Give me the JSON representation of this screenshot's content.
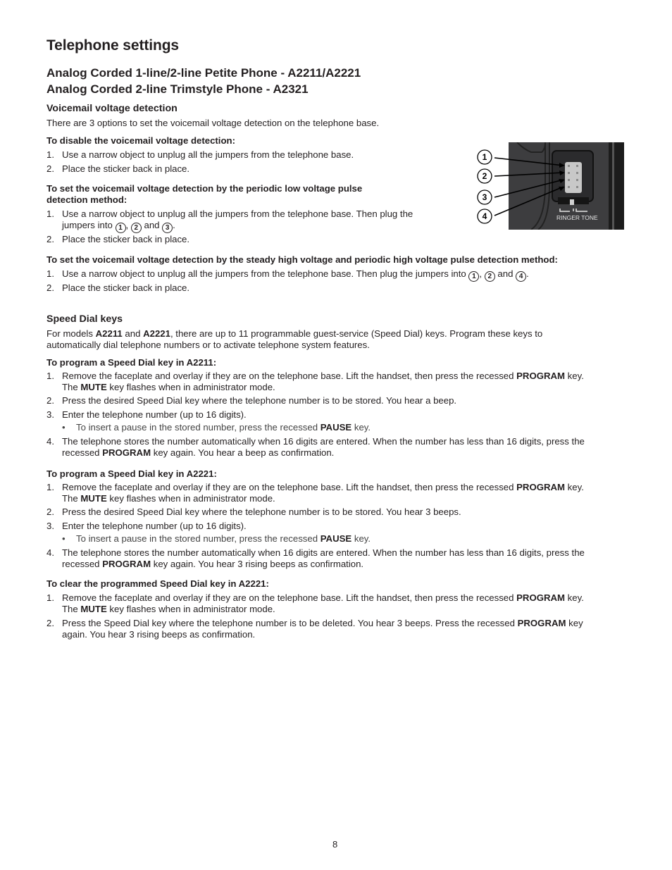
{
  "page_title": "Telephone settings",
  "model_headings": [
    "Analog Corded 1-line/2-line Petite Phone - A2211/A2221",
    "Analog Corded 2-line Trimstyle Phone - A2321"
  ],
  "voicemail": {
    "heading": "Voicemail voltage detection",
    "intro": "There are 3 options to set the voicemail voltage detection on the telephone base.",
    "disable": {
      "title": "To disable the voicemail voltage detection:",
      "steps": [
        "Use a narrow object to unplug all the jumpers from the telephone base.",
        "Place the sticker back in place."
      ]
    },
    "low_pulse": {
      "title_line1": "To set the voicemail voltage detection by the periodic low voltage pulse",
      "title_line2": "detection method:",
      "step1_line1": "Use a narrow object to unplug all the jumpers from the telephone base. Then plug the",
      "step1_prefix": "jumpers into ",
      "step1_circles": [
        "1",
        "2",
        "3"
      ],
      "sep_comma": ", ",
      "sep_and": " and ",
      "end_period": ".",
      "step2": "Place the sticker back in place."
    },
    "high_pulse": {
      "title": "To set the voicemail voltage detection by the steady high voltage and periodic high voltage pulse detection method:",
      "step1_prefix": "Use a narrow object to unplug all the jumpers from the telephone base. Then plug the jumpers into ",
      "step1_circles": [
        "1",
        "2",
        "4"
      ],
      "step2": "Place the sticker back in place."
    },
    "figure": {
      "callouts": [
        "1",
        "2",
        "3",
        "4"
      ],
      "label": "RINGER TONE",
      "colors": {
        "panel": "#3d3d3f",
        "dark": "#1c1c1c",
        "jumper": "#c8c8c8"
      }
    }
  },
  "speed_dial": {
    "heading": "Speed Dial keys",
    "intro_pre": "For models ",
    "model1": "A2211",
    "intro_and": " and ",
    "model2": "A2221",
    "intro_post": ", there are up to 11 programmable guest-service (Speed Dial) keys. Program these keys to",
    "intro_line2": "automatically dial telephone numbers or to activate telephone system features.",
    "a2211": {
      "title": "To program a Speed Dial key in A2211:",
      "s1_a": "Remove the faceplate and overlay if they are on the telephone base. Lift the handset, then press the recessed ",
      "s1_b": "PROGRAM",
      "s1_c": " key.",
      "s1_d": "The ",
      "s1_e": "MUTE",
      "s1_f": " key flashes when in administrator mode.",
      "s2": "Press the desired Speed Dial key where the telephone number is to be stored. You hear a beep.",
      "s3": "Enter the telephone number (up to 16 digits).",
      "bullet_a": "To insert a pause in the stored number, press the recessed ",
      "bullet_b": "PAUSE",
      "bullet_c": " key.",
      "s4_a": "The telephone stores the number automatically when 16 digits are entered. When the number has less than 16 digits, press the",
      "s4_b": "recessed ",
      "s4_c": "PROGRAM",
      "s4_d": " key again. You hear a beep as confirmation."
    },
    "a2221": {
      "title": "To program a Speed Dial key in A2221:",
      "s1_a": "Remove the faceplate and overlay if they are on the telephone base. Lift the handset, then press the recessed ",
      "s1_b": "PROGRAM",
      "s1_c": " key.",
      "s1_d": "The ",
      "s1_e": "MUTE",
      "s1_f": " key flashes when in administrator mode.",
      "s2": "Press the desired Speed Dial key where the telephone number is to be stored. You hear 3 beeps.",
      "s3": "Enter the telephone number (up to 16 digits).",
      "bullet_a": "To insert a pause in the stored number, press the recessed ",
      "bullet_b": "PAUSE",
      "bullet_c": " key.",
      "s4_a": "The telephone stores the number automatically when 16 digits are entered. When the number has less than 16 digits, press the",
      "s4_b": "recessed ",
      "s4_c": "PROGRAM",
      "s4_d": " key again. You hear 3 rising beeps as confirmation."
    },
    "clear": {
      "title": "To clear the programmed Speed Dial key in A2221:",
      "s1_a": "Remove the faceplate and overlay if they are on the telephone base. Lift the handset, then press the recessed ",
      "s1_b": "PROGRAM",
      "s1_c": " key.",
      "s1_d": "The ",
      "s1_e": "MUTE",
      "s1_f": " key flashes when in administrator mode.",
      "s2_a": "Press the Speed Dial key where the telephone number is to be deleted. You hear 3 beeps. Press the recessed ",
      "s2_b": "PROGRAM",
      "s2_c": " key",
      "s2_d": "again. You hear 3 rising beeps as confirmation."
    }
  },
  "numbers": [
    "1.",
    "2.",
    "3.",
    "4."
  ],
  "bullet_glyph": "•",
  "page_number": "8"
}
